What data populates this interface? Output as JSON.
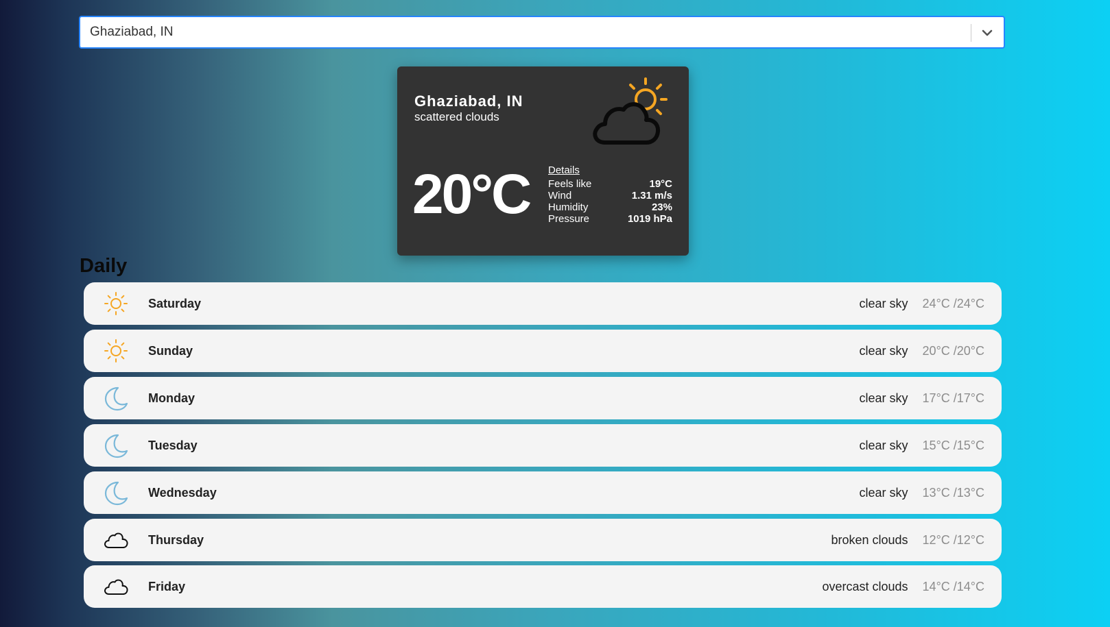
{
  "search": {
    "value": "Ghaziabad, IN",
    "dropdown_icon": "chevron-down-icon"
  },
  "current": {
    "city": "Ghaziabad, IN",
    "description": "scattered clouds",
    "icon": "partly-cloudy-icon",
    "temperature": "20°C",
    "details_title": "Details",
    "details": [
      {
        "label": "Feels like",
        "value": "19°C"
      },
      {
        "label": "Wind",
        "value": "1.31 m/s"
      },
      {
        "label": "Humidity",
        "value": "23%"
      },
      {
        "label": "Pressure",
        "value": "1019 hPa"
      }
    ]
  },
  "daily": {
    "title": "Daily",
    "days": [
      {
        "name": "Saturday",
        "description": "clear sky",
        "temp": "24°C /24°C",
        "icon": "sun-icon"
      },
      {
        "name": "Sunday",
        "description": "clear sky",
        "temp": "20°C /20°C",
        "icon": "sun-icon"
      },
      {
        "name": "Monday",
        "description": "clear sky",
        "temp": "17°C /17°C",
        "icon": "moon-icon"
      },
      {
        "name": "Tuesday",
        "description": "clear sky",
        "temp": "15°C /15°C",
        "icon": "moon-icon"
      },
      {
        "name": "Wednesday",
        "description": "clear sky",
        "temp": "13°C /13°C",
        "icon": "moon-icon"
      },
      {
        "name": "Thursday",
        "description": "broken clouds",
        "temp": "12°C /12°C",
        "icon": "cloud-icon"
      },
      {
        "name": "Friday",
        "description": "overcast clouds",
        "temp": "14°C /14°C",
        "icon": "cloud-icon"
      }
    ]
  },
  "colors": {
    "sun": "#f5a623",
    "moon": "#7ab8d9",
    "card_bg": "#333333",
    "row_bg": "#f4f4f4",
    "select_border": "#2684ff"
  }
}
